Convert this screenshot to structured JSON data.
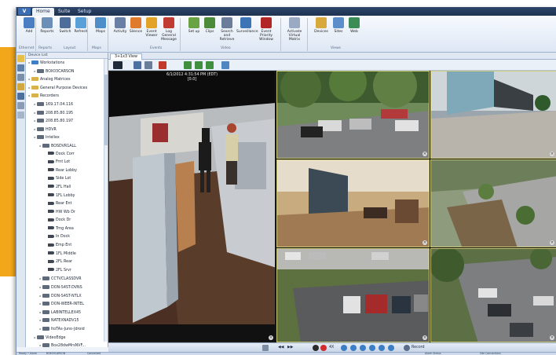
{
  "app": {
    "logo_text": "V",
    "tabs": [
      "Home",
      "Suite",
      "Setup"
    ]
  },
  "ribbon": {
    "buttons": [
      {
        "label": "Add",
        "icon": "add-icon",
        "color": "#4a7fc4"
      },
      {
        "label": "Reports",
        "icon": "reports-icon",
        "color": "#6c8fb8"
      },
      {
        "label": "Switch",
        "icon": "switch-icon",
        "color": "#4d6d9b"
      },
      {
        "label": "Refresh",
        "icon": "refresh-icon",
        "color": "#5aa0d8"
      },
      {
        "label": "Maps",
        "icon": "maps-icon",
        "color": "#4f8fc9"
      },
      {
        "label": "Activity",
        "icon": "activity-icon",
        "color": "#6a7fa5"
      },
      {
        "label": "Silence",
        "icon": "silence-icon",
        "color": "#e07a2c"
      },
      {
        "label": "Event Viewer",
        "icon": "event-viewer-icon",
        "color": "#e2a326"
      },
      {
        "label": "Log General Message",
        "icon": "log-message-icon",
        "color": "#c23b33"
      },
      {
        "label": "Set up",
        "icon": "setup-icon",
        "color": "#6aa343"
      },
      {
        "label": "Clips",
        "icon": "clips-icon",
        "color": "#4c8b3a"
      },
      {
        "label": "Search and Retrieve",
        "icon": "search-retrieve-icon",
        "color": "#6b7d9a"
      },
      {
        "label": "Surveillance",
        "icon": "surveillance-icon",
        "color": "#3d74b5"
      },
      {
        "label": "Event Priority Window",
        "icon": "event-priority-icon",
        "color": "#b32626"
      },
      {
        "label": "Activate Virtual Matrix",
        "icon": "virtual-matrix-icon",
        "color": "#9aaac2"
      },
      {
        "label": "Devices",
        "icon": "devices-icon",
        "color": "#d8a93c"
      },
      {
        "label": "Sites",
        "icon": "sites-icon",
        "color": "#5b8ecb"
      },
      {
        "label": "Web",
        "icon": "web-icon",
        "color": "#3b8d55"
      }
    ],
    "groups": [
      "Ethernet",
      "Reports",
      "Layout",
      "Maps",
      "Events",
      "Video",
      "Views"
    ]
  },
  "tree": {
    "header": "Device List",
    "items": [
      {
        "label": "Workstations",
        "depth": 0,
        "kind": "blue"
      },
      {
        "label": "BOX03CARSON",
        "depth": 1,
        "kind": "pc"
      },
      {
        "label": "Analog Matrices",
        "depth": 0,
        "kind": "fold"
      },
      {
        "label": "General Purpose Devices",
        "depth": 0,
        "kind": "fold"
      },
      {
        "label": "Recorders",
        "depth": 0,
        "kind": "fold"
      },
      {
        "label": "169.17.04.116",
        "depth": 1,
        "kind": "pc"
      },
      {
        "label": "208.85.80.195",
        "depth": 1,
        "kind": "pc"
      },
      {
        "label": "208.85.80.197",
        "depth": 1,
        "kind": "pc"
      },
      {
        "label": "HDVR",
        "depth": 1,
        "kind": "pc"
      },
      {
        "label": "Intellex",
        "depth": 1,
        "kind": "pc"
      },
      {
        "label": "BOSDVR1ALL",
        "depth": 2,
        "kind": "pc"
      },
      {
        "label": "Dock Corr",
        "depth": 3,
        "kind": "cam"
      },
      {
        "label": "Frnt Lot",
        "depth": 3,
        "kind": "cam"
      },
      {
        "label": "Rear Lobby",
        "depth": 3,
        "kind": "cam"
      },
      {
        "label": "Side Lot",
        "depth": 3,
        "kind": "cam"
      },
      {
        "label": "2FL Hall",
        "depth": 3,
        "kind": "cam"
      },
      {
        "label": "1FL Lobby",
        "depth": 3,
        "kind": "cam"
      },
      {
        "label": "Rear Ent",
        "depth": 3,
        "kind": "cam"
      },
      {
        "label": "HW Wb Dr",
        "depth": 3,
        "kind": "cam"
      },
      {
        "label": "Dock Dr",
        "depth": 3,
        "kind": "cam"
      },
      {
        "label": "Trng Area",
        "depth": 3,
        "kind": "cam"
      },
      {
        "label": "In Dock",
        "depth": 3,
        "kind": "cam"
      },
      {
        "label": "Emp Ent",
        "depth": 3,
        "kind": "cam"
      },
      {
        "label": "1FL Middle",
        "depth": 3,
        "kind": "cam"
      },
      {
        "label": "2FL Rear",
        "depth": 3,
        "kind": "cam"
      },
      {
        "label": "2FL Srvr",
        "depth": 3,
        "kind": "cam"
      },
      {
        "label": "CCTVCLASSDVR",
        "depth": 2,
        "kind": "pc"
      },
      {
        "label": "DON-S4ST-DVNS",
        "depth": 2,
        "kind": "pc"
      },
      {
        "label": "DON-S4ST-NTLX",
        "depth": 2,
        "kind": "pc"
      },
      {
        "label": "DON-WEER-INTEL",
        "depth": 2,
        "kind": "pc"
      },
      {
        "label": "LABINTELLEX45",
        "depth": 2,
        "kind": "pc"
      },
      {
        "label": "NATEXNADV15",
        "depth": 2,
        "kind": "pc"
      },
      {
        "label": "ItoTAs-Juno-Jdroid",
        "depth": 2,
        "kind": "pc"
      },
      {
        "label": "VideoEdge",
        "depth": 1,
        "kind": "pc"
      },
      {
        "label": "Box28dwMrsNVF...",
        "depth": 2,
        "kind": "pc"
      }
    ]
  },
  "view": {
    "tab_label": "3+1x3 View",
    "main_osd": "6/1/2012 4:31:54 PM (EDT)",
    "main_osd_sub": "[0.0]",
    "tool_colors": [
      "#1f2a38",
      "#4a6fa0",
      "#6a7d99",
      "#c0392b",
      "#3f8f3f",
      "#3f8f3f",
      "#3f8f3f",
      "#4e86c2"
    ]
  },
  "playback": {
    "reverse_label": "◀◀",
    "forward_label": "▶▶",
    "speed_label": "4X",
    "record_label": "Record"
  },
  "status": {
    "left": "Ready • Alarm",
    "user": "BOX03CARSON",
    "connection": "Connected",
    "right_a": "Alarm Status",
    "right_b": "Site Connections"
  }
}
